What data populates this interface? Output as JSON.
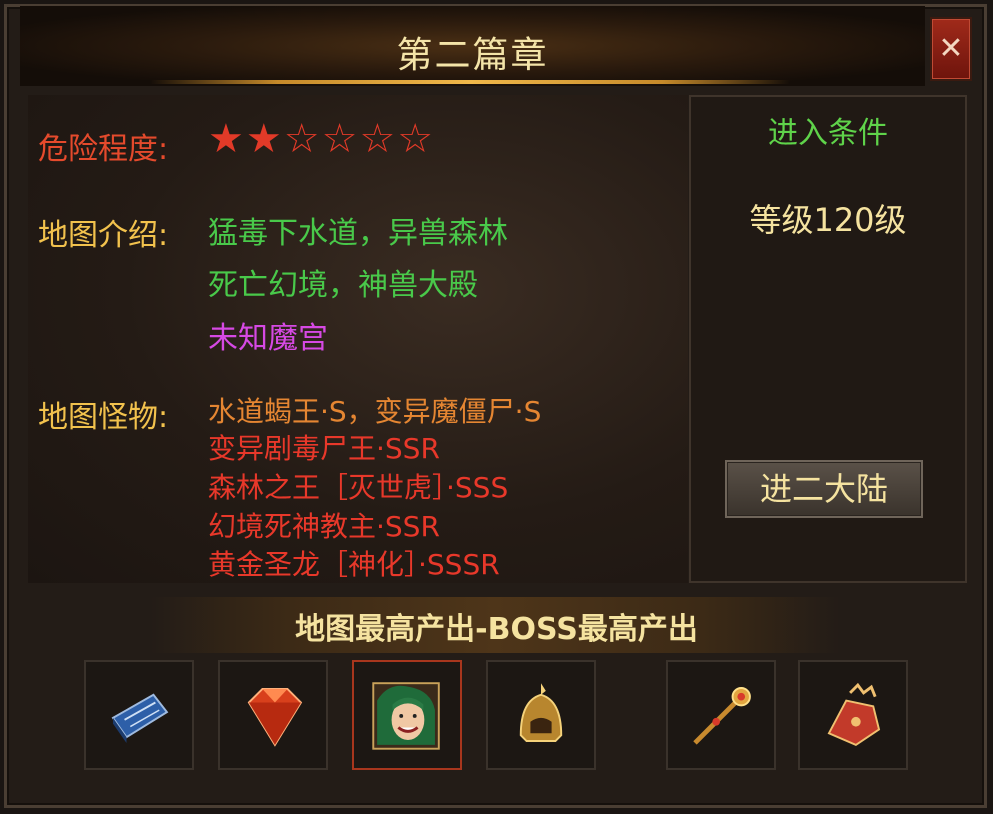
{
  "window": {
    "title": "第二篇章",
    "close_label": "✕"
  },
  "danger": {
    "label": "危险程度:",
    "level": 2,
    "max": 6
  },
  "intro": {
    "label": "地图介绍:",
    "lines": [
      {
        "text": "猛毒下水道，异兽森林",
        "color": "#49c94a"
      },
      {
        "text": "死亡幻境，神兽大殿",
        "color": "#49c94a"
      },
      {
        "text": "未知魔宫",
        "color": "#d649e4"
      }
    ]
  },
  "monsters": {
    "label": "地图怪物:",
    "lines": [
      {
        "text": "水道蝎王·S，变异魔僵尸·S",
        "color": "#e58632"
      },
      {
        "text": "变异剧毒尸王·SSR",
        "color": "#e8382a"
      },
      {
        "text": "森林之王［灭世虎］·SSS",
        "color": "#e8382a"
      },
      {
        "text": "幻境死神教主·SSR",
        "color": "#e8382a"
      },
      {
        "text": "黄金圣龙［神化］·SSSR",
        "color": "#e8382a"
      }
    ]
  },
  "entry": {
    "title": "进入条件",
    "requirement": "等级120级",
    "button_label": "进二大陆"
  },
  "drops": {
    "title": "地图最高产出-BOSS最高产出",
    "items": [
      {
        "icon": "blue-book-icon"
      },
      {
        "icon": "red-gem-icon"
      },
      {
        "icon": "hero-portrait-icon"
      },
      {
        "icon": "golden-helmet-icon"
      },
      {
        "icon": "golden-scepter-icon"
      },
      {
        "icon": "red-gauntlet-icon"
      }
    ]
  },
  "colors": {
    "label_red": "#e54a2c",
    "label_gold": "#f2c24d",
    "green": "#49c94a",
    "purple": "#d649e4",
    "orange": "#e58632",
    "red": "#e8382a"
  }
}
